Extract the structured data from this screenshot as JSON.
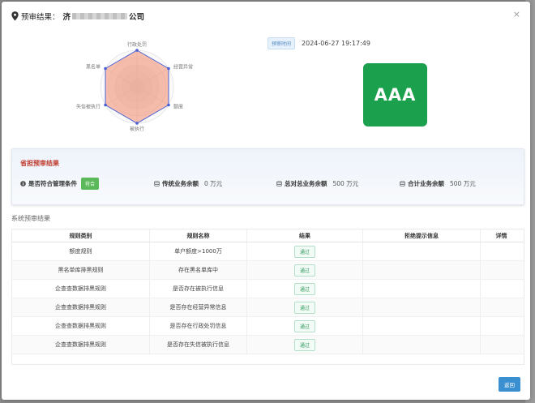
{
  "header": {
    "title_label": "预审结果：",
    "company_prefix": "济",
    "company_suffix": "公司",
    "close_glyph": "×"
  },
  "radar": {
    "axes": [
      "行政处罚",
      "经营异常",
      "额度",
      "被执行",
      "失信被执行",
      "黑名单"
    ],
    "values": [
      1,
      1,
      1,
      1,
      1,
      1
    ],
    "color": "#4a5fd6"
  },
  "time": {
    "tag": "预审时间",
    "value": "2024-06-27 19:17:49"
  },
  "grade": {
    "value": "AAA",
    "color": "#1ba14d"
  },
  "province_card": {
    "title": "省担预审结果",
    "metrics": [
      {
        "icon": "info-icon",
        "label": "是否符合管理条件",
        "value": "符合"
      },
      {
        "icon": "database-icon",
        "label": "传统业务余额",
        "value": "0 万元"
      },
      {
        "icon": "database-icon",
        "label": "总对总业务余额",
        "value": "500 万元"
      },
      {
        "icon": "database-icon",
        "label": "合计业务余额",
        "value": "500 万元"
      }
    ]
  },
  "system_title": "系统预审结果",
  "table": {
    "columns": [
      "规则类别",
      "规则名称",
      "结果",
      "拒绝提示信息",
      "详情"
    ],
    "rows": [
      {
        "category": "额度规则",
        "name": "单户额度>1000万",
        "result": "通过",
        "reject": "",
        "detail": ""
      },
      {
        "category": "黑名单库排黑规则",
        "name": "存在黑名单库中",
        "result": "通过",
        "reject": "",
        "detail": ""
      },
      {
        "category": "企查查数据排黑规则",
        "name": "是否存在被执行信息",
        "result": "通过",
        "reject": "",
        "detail": ""
      },
      {
        "category": "企查查数据排黑规则",
        "name": "是否存在经营异常信息",
        "result": "通过",
        "reject": "",
        "detail": ""
      },
      {
        "category": "企查查数据排黑规则",
        "name": "是否存在行政处罚信息",
        "result": "通过",
        "reject": "",
        "detail": ""
      },
      {
        "category": "企查查数据排黑规则",
        "name": "是否存在失信被执行信息",
        "result": "通过",
        "reject": "",
        "detail": ""
      }
    ]
  },
  "footer": {
    "back_label": "返回"
  }
}
